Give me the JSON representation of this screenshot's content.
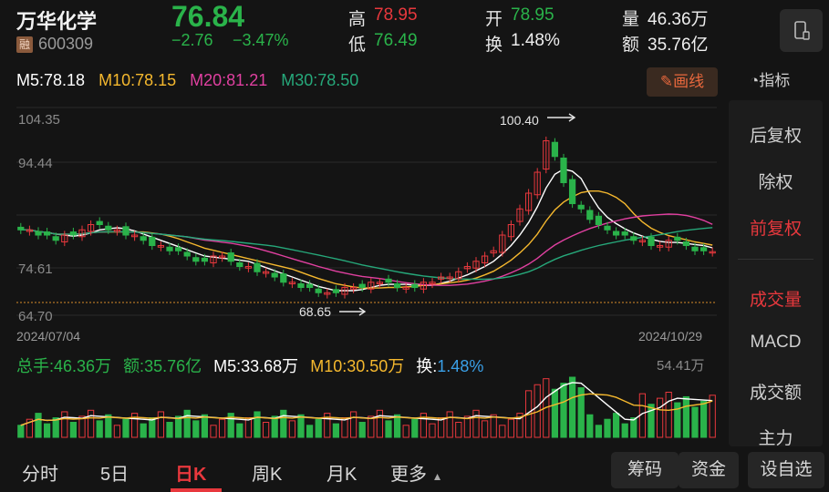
{
  "header": {
    "name": "万华化学",
    "margin_badge": "融",
    "code": "600309",
    "price": "76.84",
    "change": "−2.76",
    "change_pct": "−3.47%",
    "high_label": "高",
    "high": "78.95",
    "low_label": "低",
    "low": "76.49",
    "open_label": "开",
    "open": "78.95",
    "turnover_label": "换",
    "turnover": "1.48%",
    "volume_label": "量",
    "volume": "46.36万",
    "amount_label": "额",
    "amount": "35.76亿"
  },
  "ma": {
    "m5": "M5:78.18",
    "m10": "M10:78.15",
    "m20": "M20:81.21",
    "m30": "M30:78.50"
  },
  "toolbar": {
    "draw": "画线",
    "indicator": "指标"
  },
  "side_panel": [
    "后复权",
    "除权",
    "前复权",
    "成交量",
    "MACD",
    "成交额",
    "主力"
  ],
  "side_active": [
    "前复权",
    "成交量"
  ],
  "chart": {
    "y_ticks": [
      "104.35",
      "94.44",
      "74.61",
      "64.70"
    ],
    "start_date": "2024/07/04",
    "end_date": "2024/10/29",
    "max_annot": "100.40",
    "min_annot": "68.65"
  },
  "chart_data": {
    "type": "candlestick",
    "ylim": [
      64.7,
      104.35
    ],
    "x_range": [
      "2024/07/04",
      "2024/10/29"
    ],
    "max": 100.4,
    "min": 68.65,
    "close_approx": [
      81,
      81,
      80,
      80,
      79,
      80,
      80,
      81,
      82,
      82,
      81,
      81,
      80,
      80,
      79,
      78,
      78,
      77,
      77,
      76,
      75,
      75,
      76,
      76,
      75,
      74,
      74,
      73,
      73,
      72,
      71,
      71,
      70,
      70,
      69,
      69,
      69,
      70,
      70,
      70,
      71,
      71,
      71,
      70,
      70,
      70,
      71,
      71,
      72,
      72,
      73,
      74,
      75,
      76,
      77,
      80,
      82,
      85,
      88,
      92,
      98,
      95,
      90,
      86,
      85,
      83,
      82,
      81,
      80,
      80,
      79,
      79,
      78,
      78,
      79,
      79,
      78,
      77,
      77,
      76.84
    ],
    "volume_max": "54.41万"
  },
  "volume": {
    "total": "总手:46.36万",
    "amount": "额:35.76亿",
    "m5": "M5:33.68万",
    "m10": "M10:30.50万",
    "turnover_label": "换:",
    "turnover": "1.48%",
    "max": "54.41万"
  },
  "tabs": [
    "分时",
    "5日",
    "日K",
    "周K",
    "月K",
    "更多"
  ],
  "active_tab": "日K",
  "bottom_pills": {
    "chips": "筹码",
    "funds": "资金",
    "settings": "设自选"
  },
  "colors": {
    "up": "#e8383d",
    "down": "#2ab34a",
    "ma5": "#ffffff",
    "ma10": "#f5b82e",
    "ma20": "#e040a0",
    "ma30": "#26a87a"
  }
}
